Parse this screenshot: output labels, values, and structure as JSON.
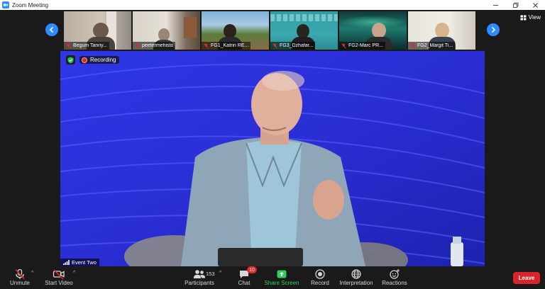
{
  "window": {
    "title": "Zoom Meeting",
    "icon": "zoom-app-icon",
    "controls": [
      "minimize-icon",
      "restore-icon",
      "close-icon"
    ]
  },
  "gallery": {
    "view_label": "View",
    "participants": [
      {
        "name": "Begum Tanriy...",
        "muted": true
      },
      {
        "name": "peetermehisto",
        "muted": true
      },
      {
        "name": "FG1_Katrin RE...",
        "muted": true
      },
      {
        "name": "FG3_Dzhafar...",
        "muted": true
      },
      {
        "name": "FG2-Marc PR...",
        "muted": true
      },
      {
        "name": "FG2_Margit Ti...",
        "muted": true
      }
    ]
  },
  "stage": {
    "recording_label": "Recording",
    "speaker_name": "Event Two"
  },
  "toolbar": {
    "unmute_label": "Unmute",
    "start_video_label": "Start Video",
    "participants_label": "Participants",
    "participants_count": "153",
    "chat_label": "Chat",
    "chat_badge": "10",
    "share_label": "Share Screen",
    "record_label": "Record",
    "interpretation_label": "Interpretation",
    "reactions_label": "Reactions",
    "leave_label": "Leave"
  },
  "colors": {
    "accent": "#2d8cff",
    "share_green": "#2fcf58",
    "leave_red": "#d9242b",
    "stage_blue": "#2a2fd8"
  }
}
